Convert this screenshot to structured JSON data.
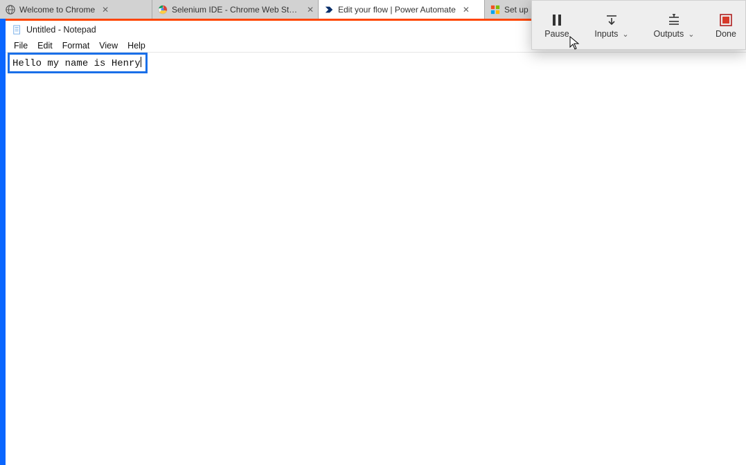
{
  "tabs": [
    {
      "label": "Welcome to Chrome",
      "icon_color": "#4a4a4a"
    },
    {
      "label": "Selenium IDE - Chrome Web Sto…",
      "icon_color": "#f14e32"
    },
    {
      "label": "Edit your flow | Power Automate",
      "icon_color": "#0a2f6b"
    },
    {
      "label": "Set up",
      "icon_color": "#00a4ef"
    }
  ],
  "notepad": {
    "window_title": "Untitled - Notepad",
    "menu": {
      "file": "File",
      "edit": "Edit",
      "format": "Format",
      "view": "View",
      "help": "Help"
    },
    "content": "Hello my name is Henry"
  },
  "recorder": {
    "pause": "Pause",
    "inputs": "Inputs",
    "outputs": "Outputs",
    "done": "Done"
  }
}
